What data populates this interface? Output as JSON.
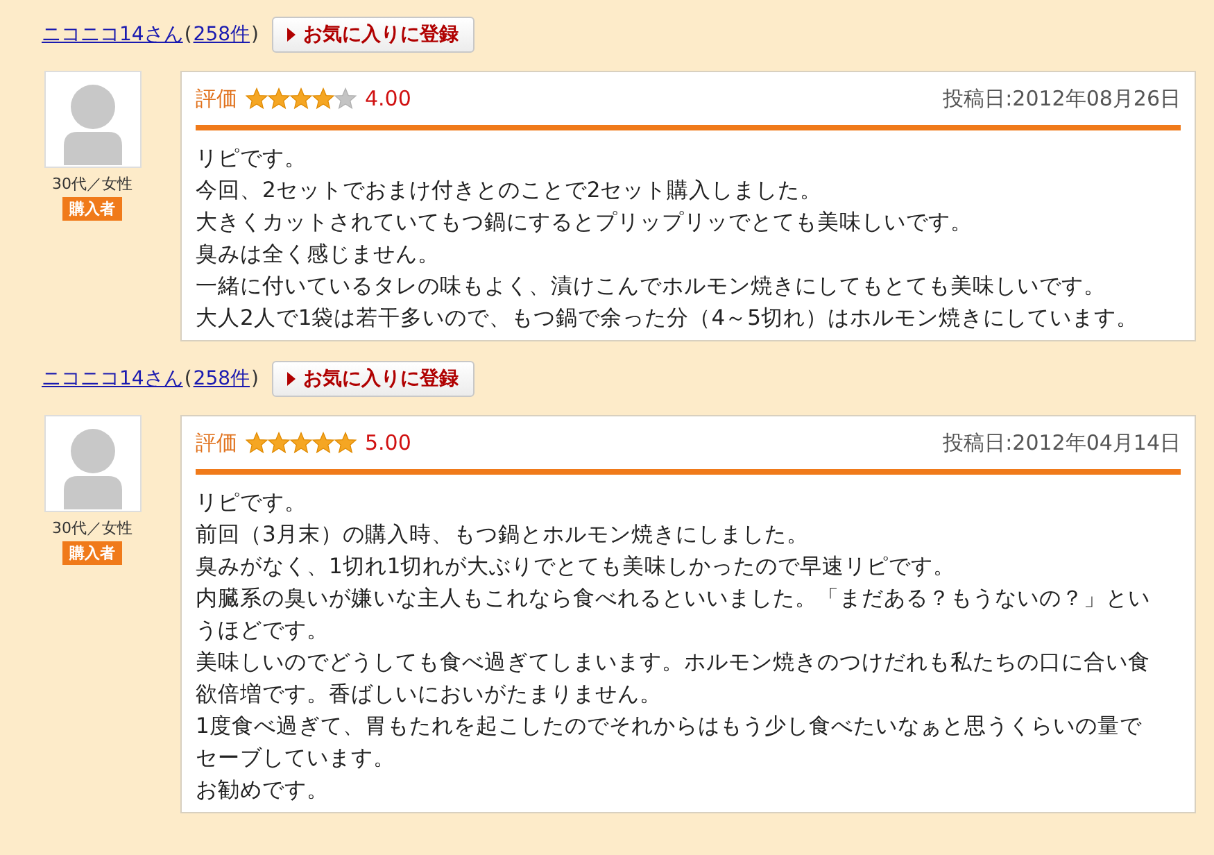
{
  "reviews": [
    {
      "reviewer": "ニコニコ14さん",
      "paren_open": "(",
      "count": "258件",
      "paren_close": ")",
      "favorite_button": "お気に入りに登録",
      "age_gender": "30代／女性",
      "badge": "購入者",
      "rating_label": "評価",
      "stars": 4,
      "score": "4.00",
      "date": "投稿日:2012年08月26日",
      "body": [
        "リピです。",
        "今回、2セットでおまけ付きとのことで2セット購入しました。",
        "大きくカットされていてもつ鍋にするとプリップリッでとても美味しいです。",
        "臭みは全く感じません。",
        "一緒に付いているタレの味もよく、漬けこんでホルモン焼きにしてもとても美味しいです。",
        "大人2人で1袋は若干多いので、もつ鍋で余った分（4～5切れ）はホルモン焼きにしています。"
      ]
    },
    {
      "reviewer": "ニコニコ14さん",
      "paren_open": "(",
      "count": "258件",
      "paren_close": ")",
      "favorite_button": "お気に入りに登録",
      "age_gender": "30代／女性",
      "badge": "購入者",
      "rating_label": "評価",
      "stars": 5,
      "score": "5.00",
      "date": "投稿日:2012年04月14日",
      "body": [
        "リピです。",
        "前回（3月末）の購入時、もつ鍋とホルモン焼きにしました。",
        "臭みがなく、1切れ1切れが大ぶりでとても美味しかったので早速リピです。",
        "内臓系の臭いが嫌いな主人もこれなら食べれるといいました。「まだある？もうないの？」というほどです。",
        "美味しいのでどうしても食べ過ぎてしまいます。ホルモン焼きのつけだれも私たちの口に合い食欲倍増です。香ばしいにおいがたまりません。",
        "1度食べ過ぎて、胃もたれを起こしたのでそれからはもう少し食べたいなぁと思うくらいの量でセーブしています。",
        "お勧めです。"
      ]
    }
  ]
}
